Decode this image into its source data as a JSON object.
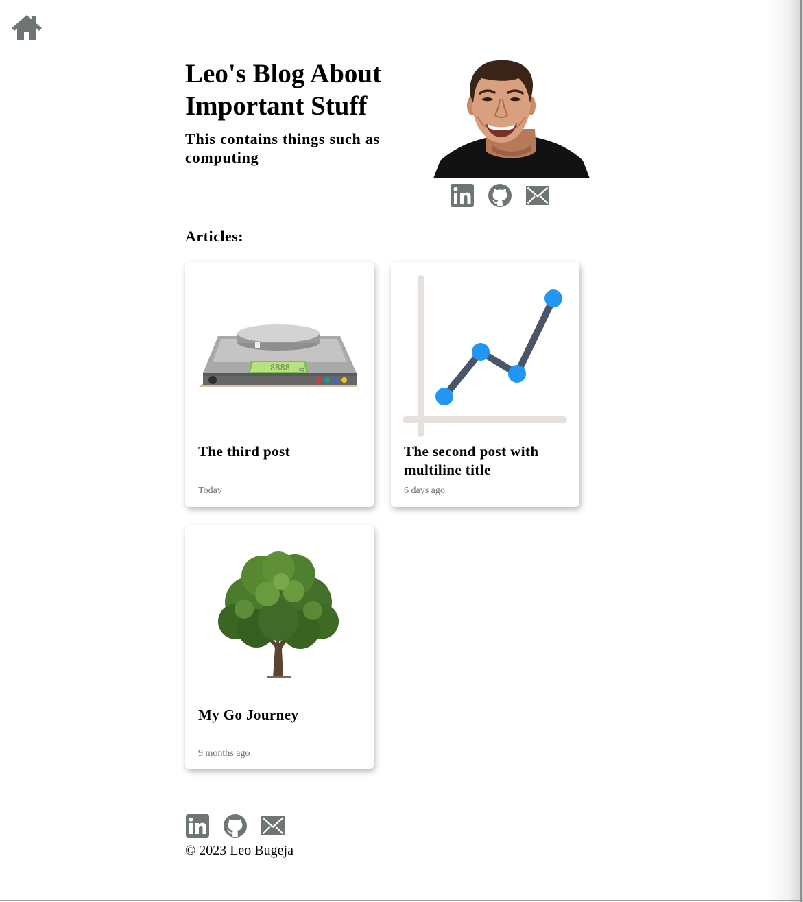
{
  "header": {
    "title": "Leo's Blog About Important Stuff",
    "subtitle": "This contains things such as computing"
  },
  "icons": {
    "home": "home-icon",
    "linkedin": "linkedin-icon",
    "github": "github-icon",
    "email": "email-icon"
  },
  "colors": {
    "icon_gray": "#6d7675",
    "chart_blue": "#2196f3",
    "chart_line": "#4a5568",
    "axis": "#e6e1dc"
  },
  "articles": {
    "heading": "Articles:",
    "items": [
      {
        "title": "The third post",
        "date": "Today",
        "image": "scale"
      },
      {
        "title": "The second post with multiline title",
        "date": "6 days ago",
        "image": "line-chart"
      },
      {
        "title": "My Go Journey",
        "date": "9 months ago",
        "image": "tree"
      }
    ]
  },
  "footer": {
    "copyright": "© 2023 Leo Bugeja"
  }
}
